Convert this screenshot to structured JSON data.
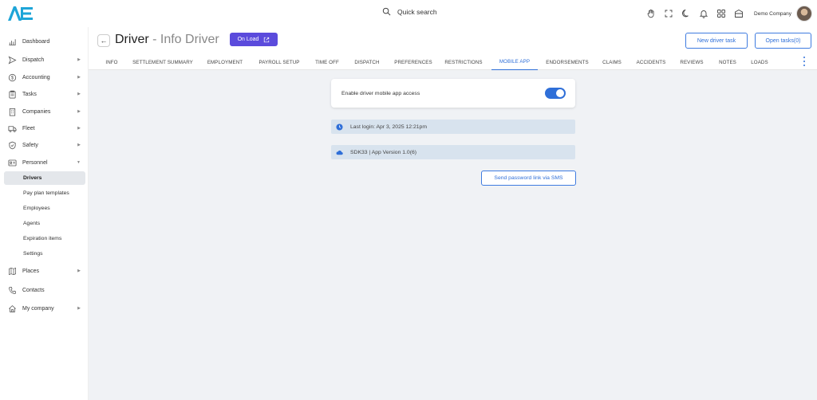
{
  "brand": {
    "accent": "#2f6fd8",
    "badge_color": "#5b4bdc"
  },
  "topbar": {
    "search_label": "Quick search",
    "icons": [
      "hand-icon",
      "fullscreen-icon",
      "moon-icon",
      "bell-icon",
      "apps-grid-icon",
      "garage-icon"
    ],
    "company_name": "Demo Company"
  },
  "sidebar": {
    "items": [
      {
        "label": "Dashboard",
        "icon": "chart-icon",
        "has_arrow": false
      },
      {
        "label": "Dispatch",
        "icon": "send-icon",
        "has_arrow": true
      },
      {
        "label": "Accounting",
        "icon": "dollar-icon",
        "has_arrow": true
      },
      {
        "label": "Tasks",
        "icon": "clipboard-icon",
        "has_arrow": true
      },
      {
        "label": "Companies",
        "icon": "building-icon",
        "has_arrow": true
      },
      {
        "label": "Fleet",
        "icon": "truck-icon",
        "has_arrow": true
      },
      {
        "label": "Safety",
        "icon": "shield-icon",
        "has_arrow": true
      },
      {
        "label": "Personnel",
        "icon": "id-card-icon",
        "has_arrow": true,
        "expanded": true
      }
    ],
    "personnel_sub": [
      "Drivers",
      "Pay plan templates",
      "Employees",
      "Agents",
      "Expiration items",
      "Settings"
    ],
    "personnel_active": "Drivers",
    "bottom_items": [
      {
        "label": "Places",
        "icon": "map-icon",
        "has_arrow": true
      },
      {
        "label": "Contacts",
        "icon": "phone-icon",
        "has_arrow": false
      },
      {
        "label": "My company",
        "icon": "home-icon",
        "has_arrow": true
      }
    ]
  },
  "header": {
    "title_main": "Driver",
    "title_sep": " - ",
    "title_sub": "Info Driver",
    "status_badge": "On Load",
    "new_task_label": "New driver task",
    "open_tasks_label": "Open tasks(0)"
  },
  "tabs": [
    "INFO",
    "SETTLEMENT SUMMARY",
    "EMPLOYMENT",
    "PAYROLL SETUP",
    "TIME OFF",
    "DISPATCH",
    "PREFERENCES",
    "RESTRICTIONS",
    "MOBILE APP",
    "ENDORSEMENTS",
    "CLAIMS",
    "ACCIDENTS",
    "REVIEWS",
    "NOTES",
    "LOADS"
  ],
  "active_tab": "MOBILE APP",
  "mobile_app": {
    "toggle_label": "Enable driver mobile app access",
    "toggle_on": true,
    "last_login": "Last login: Apr 3, 2025 12:21pm",
    "app_version": "SDK33 | App Version 1.0(6)",
    "sms_button": "Send password link via SMS"
  }
}
